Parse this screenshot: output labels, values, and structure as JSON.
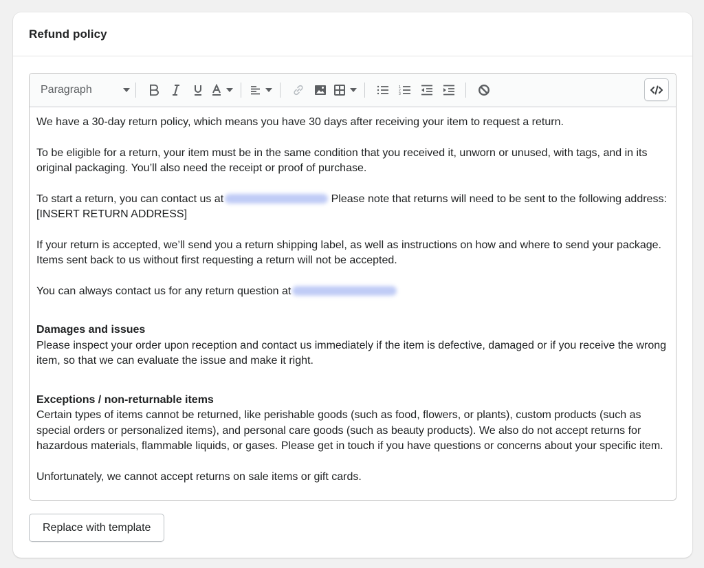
{
  "card": {
    "title": "Refund policy"
  },
  "toolbar": {
    "format_select": {
      "value": "Paragraph"
    },
    "buttons": [
      {
        "name": "bold",
        "icon": "bold-icon"
      },
      {
        "name": "italic",
        "icon": "italic-icon"
      },
      {
        "name": "underline",
        "icon": "underline-icon"
      },
      {
        "name": "text-color",
        "icon": "text-color-icon",
        "dropdown": true
      },
      {
        "name": "align",
        "icon": "align-left-icon",
        "dropdown": true
      },
      {
        "name": "link",
        "icon": "link-icon",
        "disabled": true
      },
      {
        "name": "image",
        "icon": "image-icon"
      },
      {
        "name": "table",
        "icon": "table-icon",
        "dropdown": true
      },
      {
        "name": "bulleted-list",
        "icon": "bulleted-list-icon"
      },
      {
        "name": "numbered-list",
        "icon": "numbered-list-icon"
      },
      {
        "name": "outdent",
        "icon": "outdent-icon"
      },
      {
        "name": "indent",
        "icon": "indent-icon"
      },
      {
        "name": "clear-formatting",
        "icon": "clear-formatting-icon"
      }
    ],
    "code_view": {
      "icon": "code-icon",
      "label": "</>"
    }
  },
  "content": {
    "p1": "We have a 30-day return policy, which means you have 30 days after receiving your item to request a return.",
    "p2": "To be eligible for a return, your item must be in the same condition that you received it, unworn or unused, with tags, and in its original packaging. You’ll also need the receipt or proof of purchase.",
    "p3_before": "To start a return, you can contact us at",
    "p3_after": " Please note that returns will need to be sent to the following address: [INSERT RETURN ADDRESS]",
    "p4": "If your return is accepted, we’ll send you a return shipping label, as well as instructions on how and where to send your package. Items sent back to us without first requesting a return will not be accepted.",
    "p5_before": "You can always contact us for any return question at",
    "damages_heading": "Damages and issues",
    "damages_body": "Please inspect your order upon reception and contact us immediately if the item is defective, damaged or if you receive the wrong item, so that we can evaluate the issue and make it right.",
    "exceptions_heading": "Exceptions / non-returnable items",
    "exceptions_body": "Certain types of items cannot be returned, like perishable goods (such as food, flowers, or plants), custom products (such as special orders or personalized items), and personal care goods (such as beauty products). We also do not accept returns for hazardous materials, flammable liquids, or gases. Please get in touch if you have questions or concerns about your specific item.",
    "p_sale": "Unfortunately, we cannot accept returns on sale items or gift cards."
  },
  "actions": {
    "replace_label": "Replace with template"
  },
  "colors": {
    "page_bg": "#f1f1f1",
    "card_bg": "#ffffff",
    "text": "#202223",
    "icon": "#5c5f62",
    "border": "#c4c4c4"
  }
}
